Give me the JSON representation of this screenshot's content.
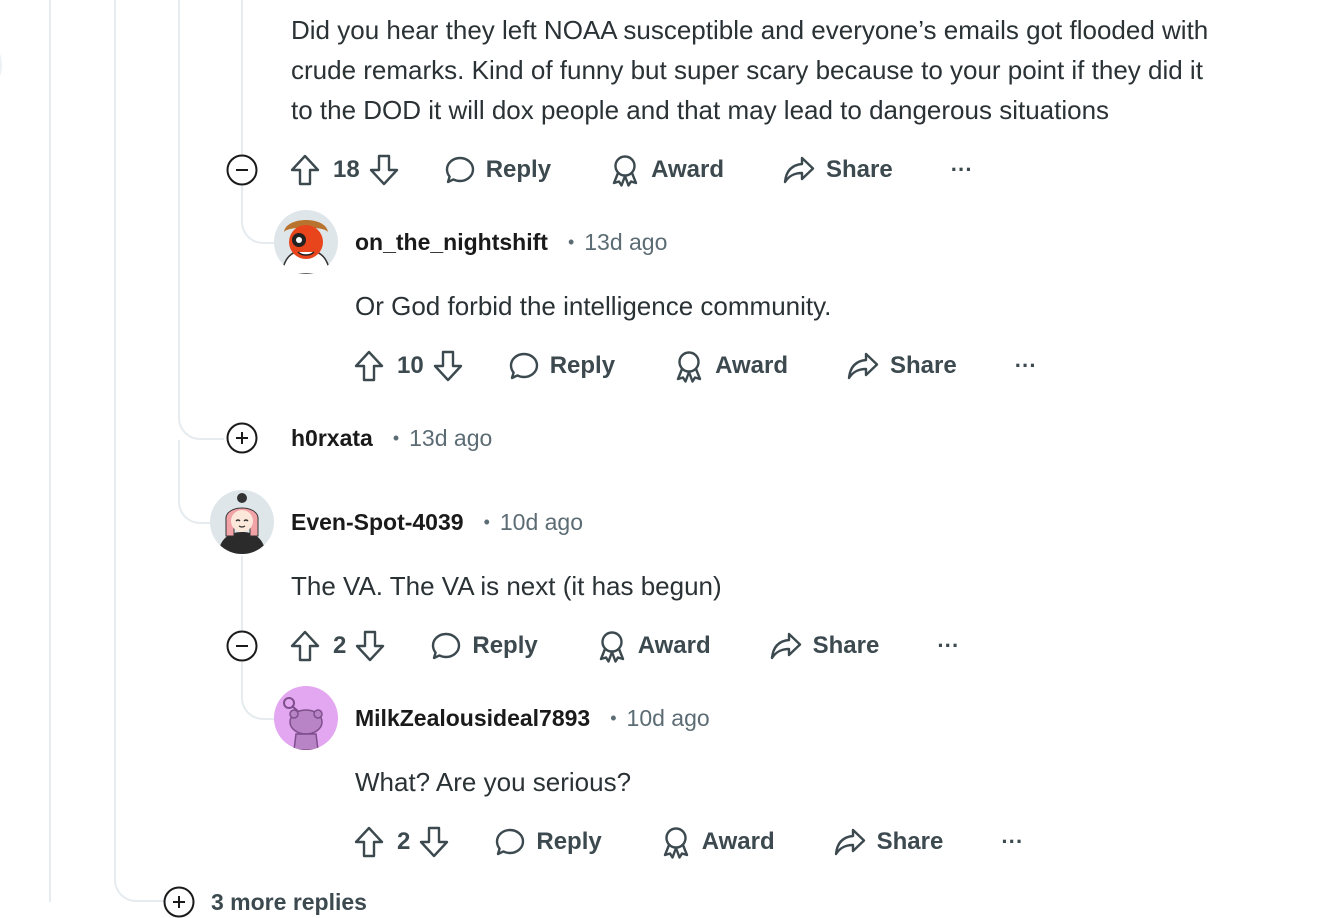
{
  "comments": {
    "c1": {
      "body": [
        "Did you hear they left NOAA susceptible and everyone’s emails got flooded with",
        "crude remarks. Kind of funny but super scary because to your point if they did it",
        "to the DOD it will dox people and that may lead to dangerous situations"
      ],
      "score": "18"
    },
    "c2": {
      "username": "on_the_nightshift",
      "time": "13d ago",
      "body": "Or God forbid the intelligence community.",
      "score": "10"
    },
    "c3": {
      "username": "h0rxata",
      "time": "13d ago"
    },
    "c4": {
      "username": "Even-Spot-4039",
      "time": "10d ago",
      "body": "The VA. The VA is next (it has begun)",
      "score": "2"
    },
    "c5": {
      "username": "MilkZealousideal7893",
      "time": "10d ago",
      "body": "What? Are you serious?",
      "score": "2"
    }
  },
  "actions": {
    "reply": "Reply",
    "award": "Award",
    "share": "Share",
    "more": "···"
  },
  "more_replies": "3 more replies",
  "colors": {
    "thread_line": "#e5ebee",
    "text": "#2a3236",
    "muted": "#5c6c74",
    "avatar_purple": "#e3a6f0"
  }
}
